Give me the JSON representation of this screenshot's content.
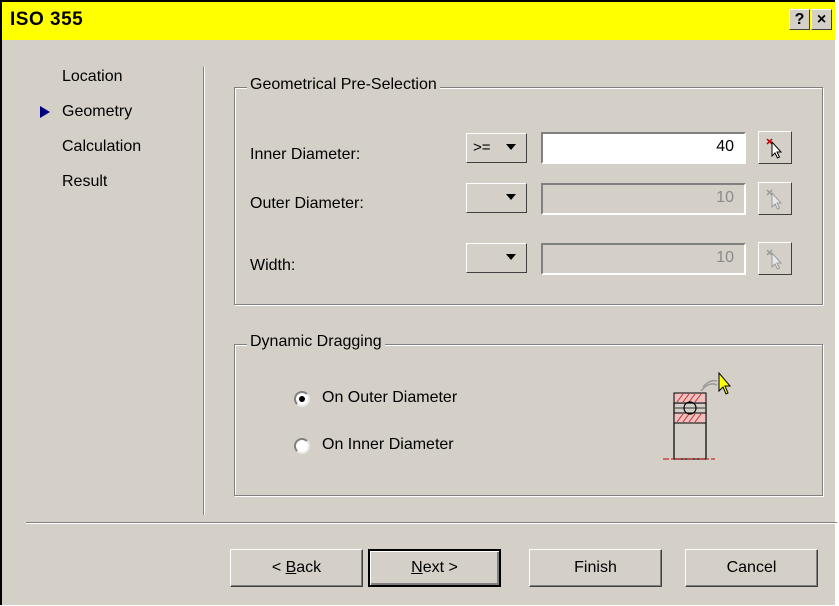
{
  "window": {
    "title": "ISO 355",
    "help_label": "?",
    "close_label": "×"
  },
  "nav": {
    "items": [
      {
        "label": "Location",
        "active": false
      },
      {
        "label": "Geometry",
        "active": true
      },
      {
        "label": "Calculation",
        "active": false
      },
      {
        "label": "Result",
        "active": false
      }
    ]
  },
  "geometry_group": {
    "title": "Geometrical Pre-Selection",
    "rows": [
      {
        "label": "Inner Diameter:",
        "operator": ">=",
        "value": "40",
        "enabled": true
      },
      {
        "label": "Outer Diameter:",
        "operator": "",
        "value": "10",
        "enabled": false
      },
      {
        "label": "Width:",
        "operator": "",
        "value": "10",
        "enabled": false
      }
    ]
  },
  "dragging_group": {
    "title": "Dynamic Dragging",
    "options": [
      {
        "label": "On Outer Diameter",
        "selected": true
      },
      {
        "label": "On Inner Diameter",
        "selected": false
      }
    ]
  },
  "buttons": {
    "back_prefix": "< ",
    "back_mnemonic": "B",
    "back_rest": "ack",
    "next_mnemonic": "N",
    "next_rest": "ext >",
    "finish": "Finish",
    "cancel": "Cancel"
  },
  "colors": {
    "titlebar": "#ffff00",
    "dialog": "#d4d0c8",
    "nav_arrow": "#000080"
  }
}
